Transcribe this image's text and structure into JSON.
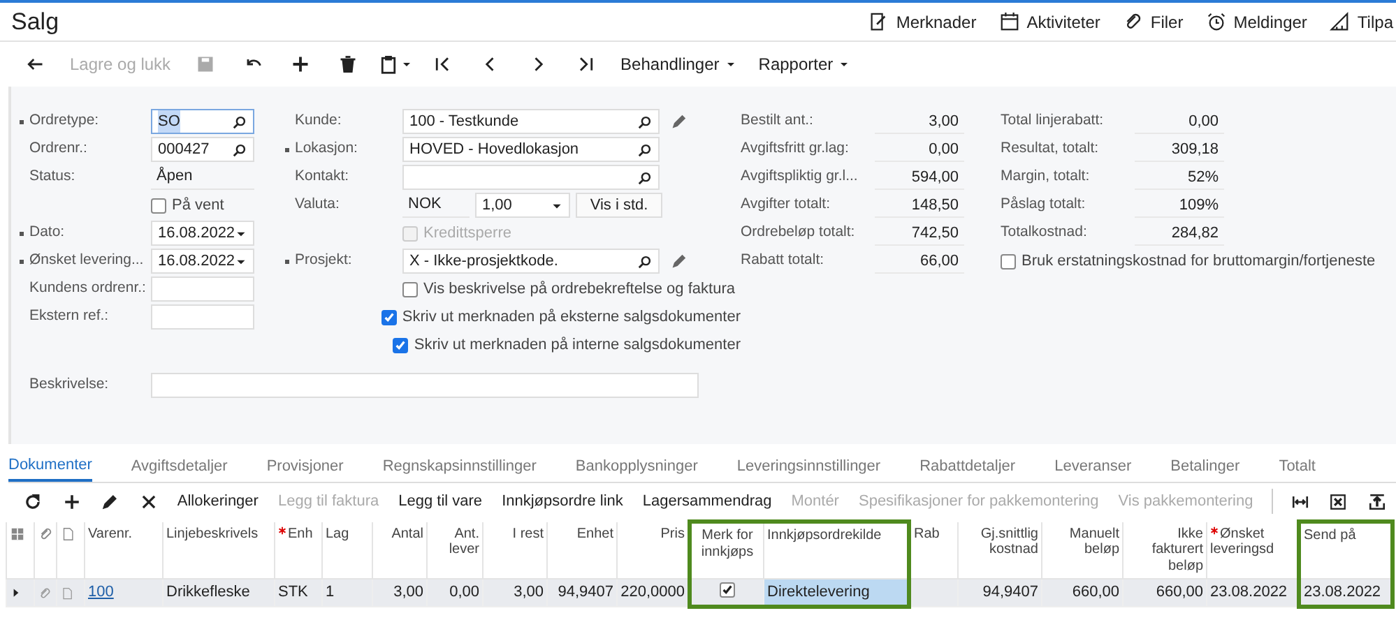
{
  "header": {
    "title": "Salg",
    "links": [
      {
        "label": "Merknader"
      },
      {
        "label": "Aktiviteter"
      },
      {
        "label": "Filer"
      },
      {
        "label": "Meldinger"
      },
      {
        "label": "Tilpa"
      }
    ]
  },
  "toolbar": [
    {
      "kind": "icon",
      "disabled": false
    },
    {
      "kind": "text",
      "label": "Lagre og lukk",
      "disabled": true
    },
    {
      "kind": "icon",
      "disabled": true
    },
    {
      "kind": "icon",
      "disabled": false
    },
    {
      "kind": "icon",
      "disabled": false
    },
    {
      "kind": "icon",
      "disabled": false
    },
    {
      "kind": "icon-menu",
      "disabled": false
    },
    {
      "kind": "icon",
      "disabled": false
    },
    {
      "kind": "icon",
      "disabled": false
    },
    {
      "kind": "icon",
      "disabled": false
    },
    {
      "kind": "icon",
      "disabled": false
    },
    {
      "kind": "menu",
      "label": "Behandlinger",
      "disabled": false
    },
    {
      "kind": "menu",
      "label": "Rapporter",
      "disabled": false
    }
  ],
  "form_left": [
    {
      "kind": "lookup",
      "label": "Ordretype:",
      "required": true,
      "value": "SO",
      "focused": true
    },
    {
      "kind": "lookup",
      "label": "Ordrenr.:",
      "required": false,
      "value": "000427",
      "focused": false
    },
    {
      "kind": "static",
      "label": "Status:",
      "required": false,
      "value": "Åpen"
    },
    {
      "kind": "checkbox",
      "label": "På vent",
      "checked": false,
      "disabled": false
    },
    {
      "kind": "date",
      "label": "Dato:",
      "required": true,
      "value": "16.08.2022"
    },
    {
      "kind": "date",
      "label": "Ønsket levering...",
      "required": true,
      "value": "16.08.2022"
    },
    {
      "kind": "text",
      "label": "Kundens ordrenr.:",
      "required": false
    },
    {
      "kind": "text",
      "label": "Ekstern ref.:",
      "required": false
    }
  ],
  "form_middle": [
    {
      "kind": "lookup",
      "label": "Kunde:",
      "required": false,
      "value": "100 - Testkunde",
      "focused": false,
      "editable": true
    },
    {
      "kind": "lookup",
      "label": "Lokasjon:",
      "required": true,
      "value": "HOVED - Hovedlokasjon",
      "focused": false,
      "editable": false
    },
    {
      "kind": "lookup",
      "label": "Kontakt:",
      "required": false,
      "focused": false,
      "editable": false
    },
    {
      "kind": "currency",
      "label": "Valuta:",
      "required": false,
      "value": "NOK",
      "rate": "1,00",
      "button": "Vis i std."
    },
    {
      "kind": "checkbox",
      "label": "Kredittsperre",
      "checked": false,
      "disabled": true
    },
    {
      "kind": "lookup",
      "label": "Prosjekt:",
      "required": true,
      "value": "X - Ikke-prosjektkode.",
      "focused": false,
      "editable": true
    },
    {
      "kind": "checkbox",
      "label": "Vis beskrivelse på ordrebekreftelse og faktura",
      "checked": false,
      "disabled": false
    },
    {
      "kind": "checkbox",
      "label": "Skriv ut merknaden på eksterne salgsdokumenter",
      "checked": true,
      "disabled": false
    },
    {
      "kind": "checkbox",
      "label": "Skriv ut merknaden på interne salgsdokumenter",
      "checked": true,
      "disabled": false
    }
  ],
  "description": {
    "label": "Beskrivelse:"
  },
  "summary_left": [
    {
      "label": "Bestilt ant.:",
      "value": "3,00"
    },
    {
      "label": "Avgiftsfritt gr.lag:",
      "value": "0,00"
    },
    {
      "label": "Avgiftspliktig gr.l...",
      "value": "594,00"
    },
    {
      "label": "Avgifter totalt:",
      "value": "148,50"
    },
    {
      "label": "Ordrebeløp totalt:",
      "value": "742,50"
    },
    {
      "label": "Rabatt totalt:",
      "value": "66,00"
    }
  ],
  "summary_right": [
    {
      "label": "Total linjerabatt:",
      "value": "0,00"
    },
    {
      "label": "Resultat, totalt:",
      "value": "309,18"
    },
    {
      "label": "Margin, totalt:",
      "value": "52%"
    },
    {
      "label": "Påslag totalt:",
      "value": "109%"
    },
    {
      "label": "Totalkostnad:",
      "value": "284,82"
    }
  ],
  "summary_checkbox": {
    "label": "Bruk erstatningskostnad for bruttomargin/fortjeneste",
    "checked": false
  },
  "tabs": [
    {
      "label": "Dokumenter",
      "selected": true
    },
    {
      "label": "Avgiftsdetaljer",
      "selected": false
    },
    {
      "label": "Provisjoner",
      "selected": false
    },
    {
      "label": "Regnskapsinnstillinger",
      "selected": false
    },
    {
      "label": "Bankopplysninger",
      "selected": false
    },
    {
      "label": "Leveringsinnstillinger",
      "selected": false
    },
    {
      "label": "Rabattdetaljer",
      "selected": false
    },
    {
      "label": "Leveranser",
      "selected": false
    },
    {
      "label": "Betalinger",
      "selected": false
    },
    {
      "label": "Totalt",
      "selected": false
    }
  ],
  "grid_toolbar": [
    {
      "kind": "icon",
      "disabled": false
    },
    {
      "kind": "icon",
      "disabled": false
    },
    {
      "kind": "icon",
      "disabled": false
    },
    {
      "kind": "icon",
      "disabled": false
    },
    {
      "kind": "text",
      "label": "Allokeringer",
      "disabled": false
    },
    {
      "kind": "text",
      "label": "Legg til faktura",
      "disabled": true
    },
    {
      "kind": "text",
      "label": "Legg til vare",
      "disabled": false
    },
    {
      "kind": "text",
      "label": "Innkjøpsordre link",
      "disabled": false
    },
    {
      "kind": "text",
      "label": "Lagersammendrag",
      "disabled": false
    },
    {
      "kind": "text",
      "label": "Montér",
      "disabled": true
    },
    {
      "kind": "text",
      "label": "Spesifikasjoner for pakkemontering",
      "disabled": true
    },
    {
      "kind": "text",
      "label": "Vis pakkemontering",
      "disabled": true
    },
    {
      "kind": "separator"
    },
    {
      "kind": "icon",
      "disabled": false
    },
    {
      "kind": "icon",
      "disabled": false
    },
    {
      "kind": "icon",
      "disabled": false
    }
  ],
  "table": {
    "columns": [
      {
        "label": "Varenr.",
        "kind": "link",
        "required": false,
        "highlighted": false
      },
      {
        "label": "Linjebeskrivels",
        "kind": "text",
        "required": false,
        "highlighted": false
      },
      {
        "label": "Enh",
        "kind": "text",
        "required": true,
        "highlighted": false
      },
      {
        "label": "Lag",
        "kind": "text",
        "required": false,
        "highlighted": false
      },
      {
        "label": "Antal",
        "kind": "number",
        "required": false,
        "highlighted": false
      },
      {
        "label": "Ant. lever",
        "kind": "number",
        "required": false,
        "highlighted": false
      },
      {
        "label": "I rest",
        "kind": "number",
        "required": false,
        "highlighted": false
      },
      {
        "label": "Enhet",
        "kind": "number",
        "required": false,
        "highlighted": false
      },
      {
        "label": "Pris",
        "kind": "number",
        "required": false,
        "highlighted": false
      },
      {
        "label": "Merk for innkjøps",
        "kind": "checkbox",
        "required": false,
        "highlighted": true
      },
      {
        "label": "Innkjøpsordrekilde",
        "kind": "text",
        "required": false,
        "highlighted": true
      },
      {
        "label": "Rab",
        "kind": "text",
        "required": false,
        "highlighted": false
      },
      {
        "label": "Gj.snittlig kostnad",
        "kind": "number",
        "required": false,
        "highlighted": false
      },
      {
        "label": "Manuelt beløp",
        "kind": "number",
        "required": false,
        "highlighted": false
      },
      {
        "label": "Ikke fakturert beløp",
        "kind": "number",
        "required": false,
        "highlighted": false
      },
      {
        "label": "Ønsket leveringsd",
        "kind": "text",
        "required": true,
        "highlighted": false
      },
      {
        "label": "Send på",
        "kind": "text",
        "required": false,
        "highlighted": true
      }
    ],
    "rows": [
      {
        "selected": true,
        "cells": [
          {
            "text": "100",
            "selected": false
          },
          {
            "text": "Drikkefleske",
            "selected": false
          },
          {
            "text": "STK",
            "selected": false
          },
          {
            "text": "1",
            "selected": false
          },
          {
            "text": "3,00",
            "selected": false
          },
          {
            "text": "0,00",
            "selected": false
          },
          {
            "text": "3,00",
            "selected": false
          },
          {
            "text": "94,9407",
            "selected": false
          },
          {
            "text": "220,0000",
            "selected": false
          },
          {
            "checked": true,
            "selected": false
          },
          {
            "text": "Direktelevering",
            "selected": true
          },
          {
            "selected": false
          },
          {
            "text": "94,9407",
            "selected": false
          },
          {
            "text": "660,00",
            "selected": false
          },
          {
            "text": "660,00",
            "selected": false
          },
          {
            "text": "23.08.2022",
            "selected": false
          },
          {
            "text": "23.08.2022",
            "selected": false
          }
        ]
      }
    ]
  }
}
